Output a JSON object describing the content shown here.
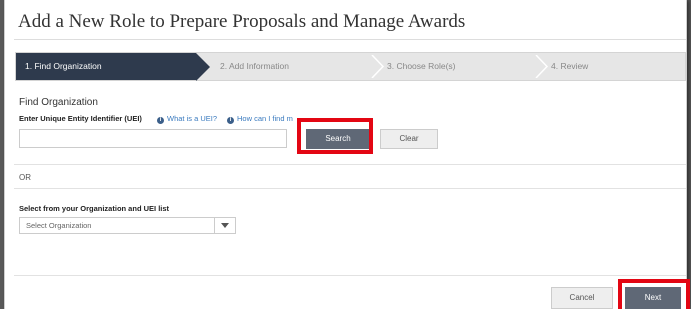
{
  "page": {
    "title": "Add a New Role to Prepare Proposals and Manage Awards"
  },
  "steps": [
    {
      "label": "1. Find Organization",
      "active": true
    },
    {
      "label": "2. Add Information",
      "active": false
    },
    {
      "label": "3. Choose Role(s)",
      "active": false
    },
    {
      "label": "4. Review",
      "active": false
    }
  ],
  "find_org": {
    "heading": "Find Organization",
    "uei_label": "Enter Unique Entity Identifier (UEI)",
    "help_what": "What is a UEI?",
    "help_how": "How can I find m",
    "uei_value": "",
    "search_label": "Search",
    "clear_label": "Clear"
  },
  "or_text": "OR",
  "org_list": {
    "label": "Select from your Organization and UEI list",
    "selected": "Select Organization"
  },
  "footer": {
    "cancel_label": "Cancel",
    "next_label": "Next"
  },
  "icons": {
    "info": "info-icon",
    "dropdown": "chevron-down-icon"
  },
  "colors": {
    "active_step": "#2e3a4d",
    "primary_button": "#5f6876",
    "highlight": "#e30613",
    "link": "#3b7bbf"
  }
}
